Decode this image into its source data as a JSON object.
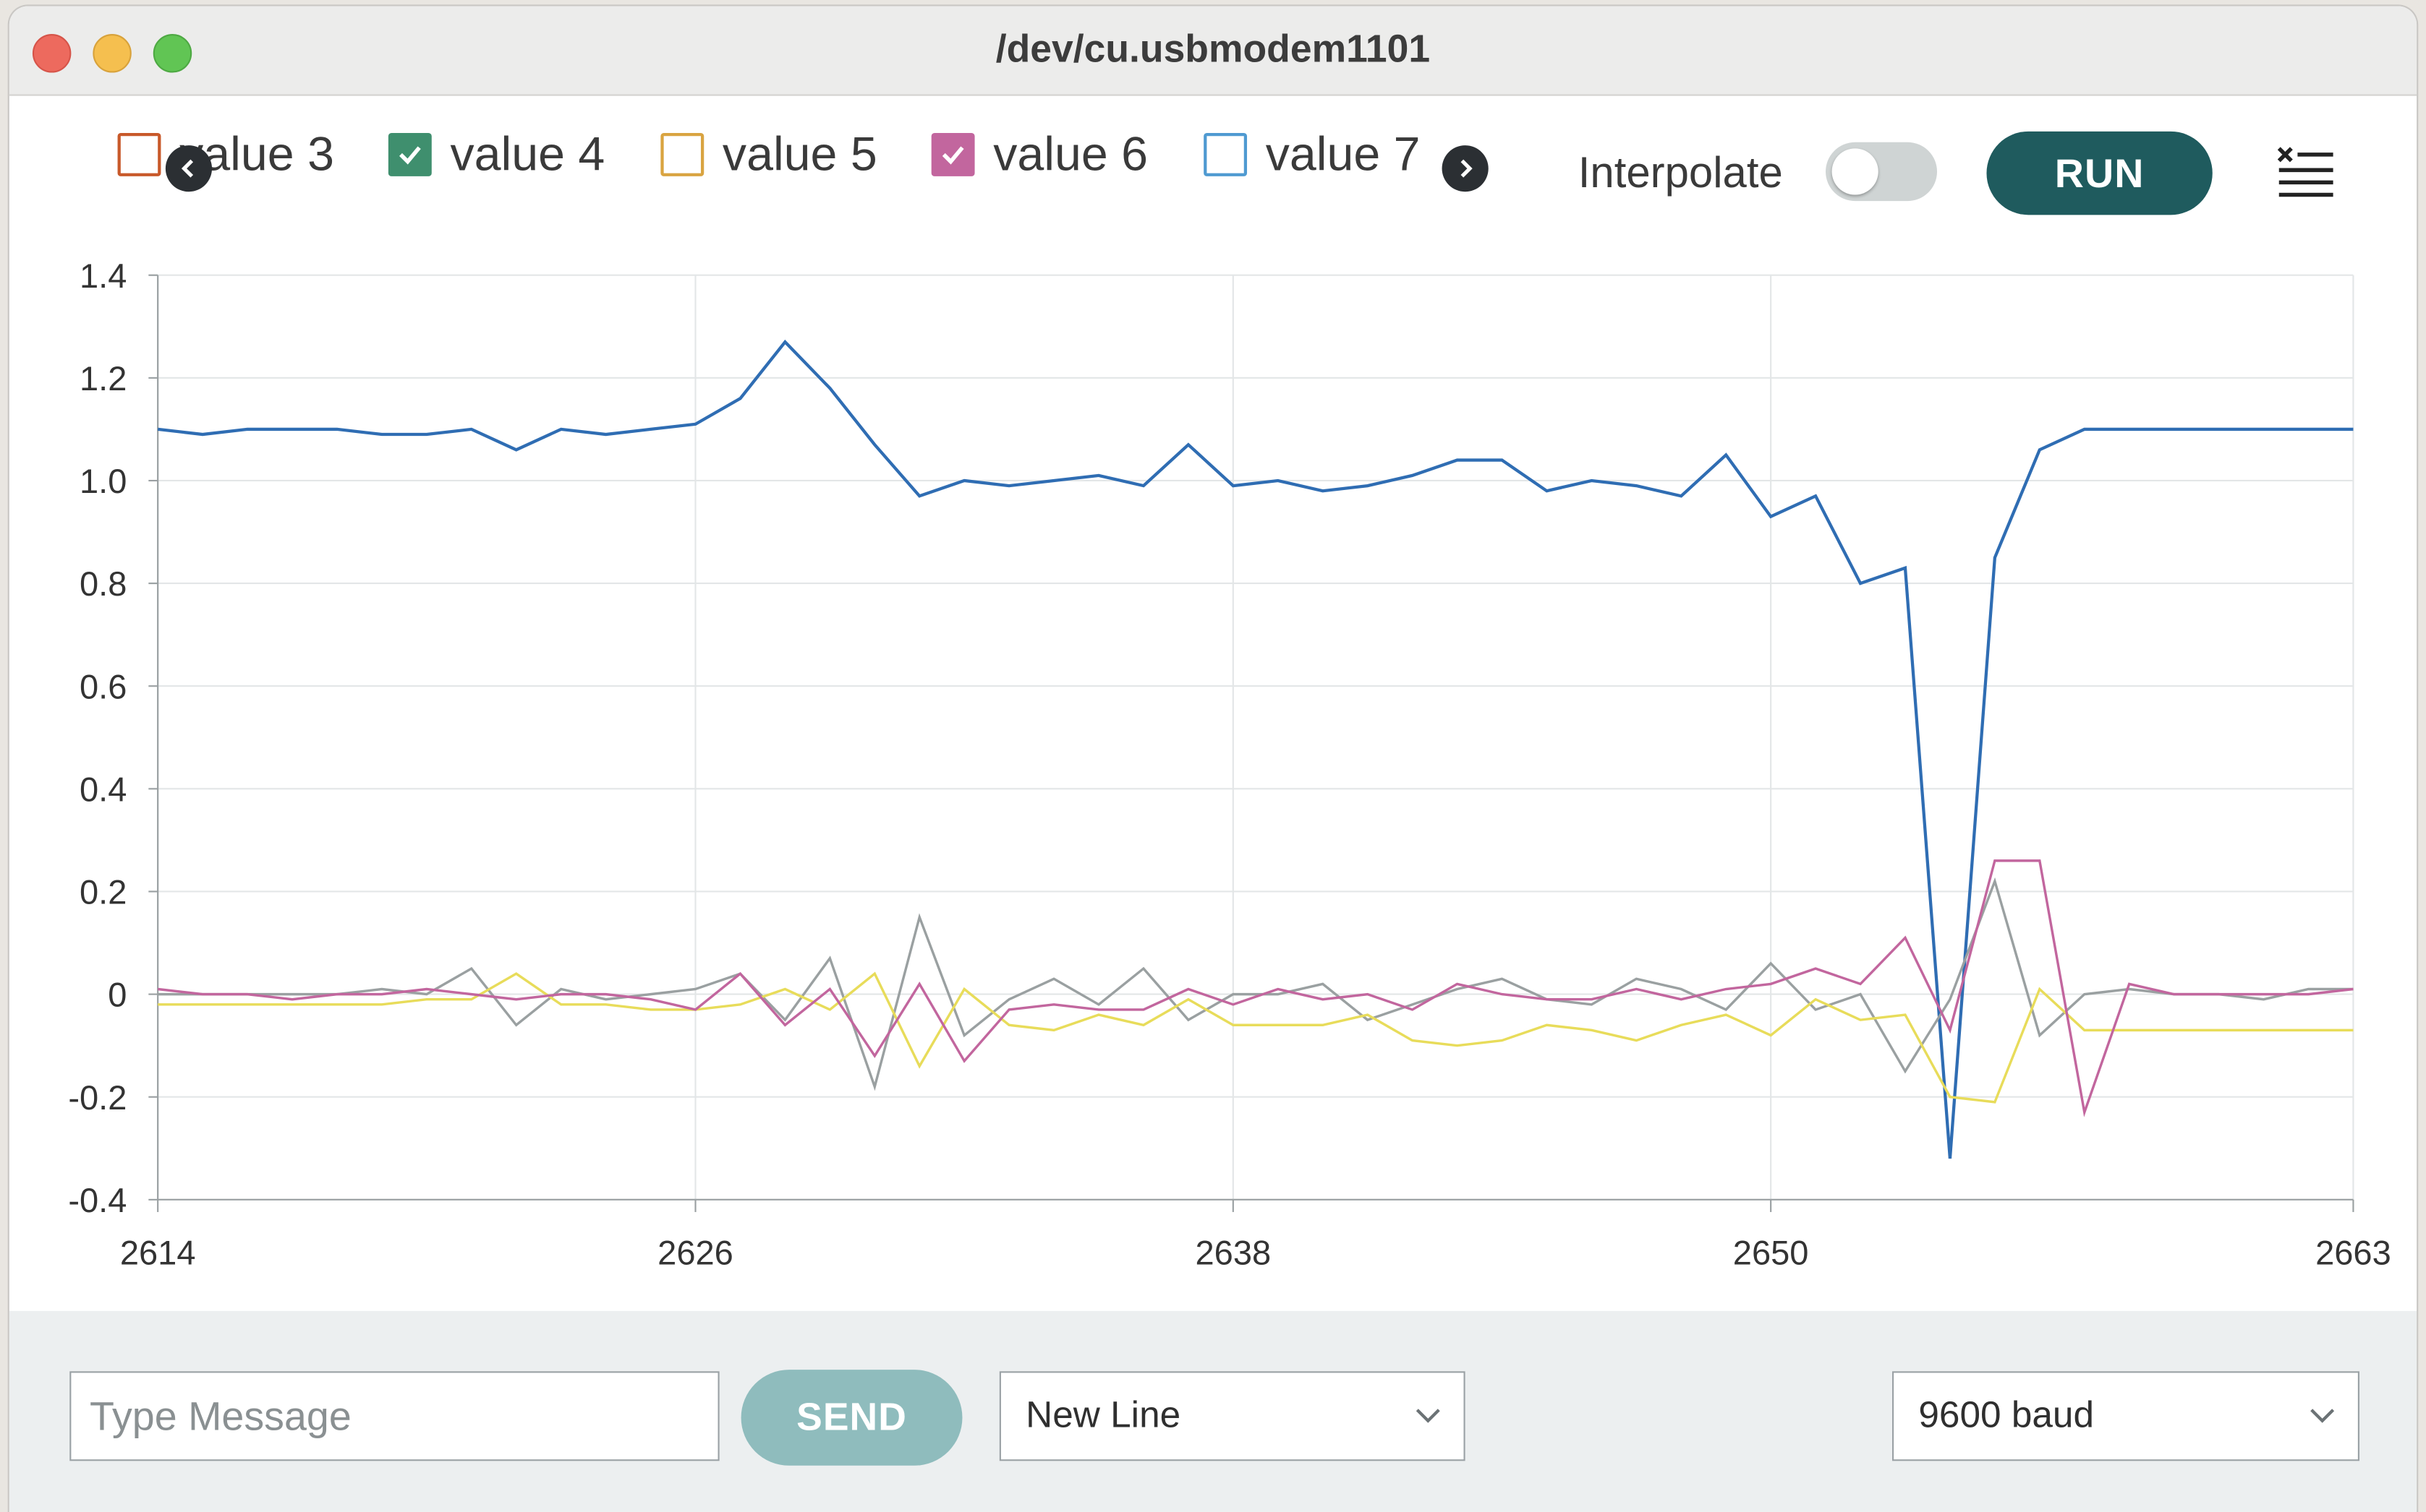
{
  "window": {
    "title": "/dev/cu.usbmodem1101"
  },
  "legend": {
    "items": [
      {
        "label": "value 3",
        "checked": false,
        "color": "#c8592a"
      },
      {
        "label": "value 4",
        "checked": true,
        "color": "#3f8f6e"
      },
      {
        "label": "value 5",
        "checked": false,
        "color": "#d9a441"
      },
      {
        "label": "value 6",
        "checked": true,
        "color": "#c2669e"
      },
      {
        "label": "value 7",
        "checked": false,
        "color": "#4f9ad1"
      }
    ],
    "prev_icon": "chevron-left-icon",
    "next_icon": "chevron-right-icon"
  },
  "toolbar": {
    "interpolate_label": "Interpolate",
    "interpolate_on": false,
    "run_label": "RUN",
    "menu_icon": "clear-list-icon"
  },
  "chart_data": {
    "type": "line",
    "x": [
      2614,
      2615,
      2616,
      2617,
      2618,
      2619,
      2620,
      2621,
      2622,
      2623,
      2624,
      2625,
      2626,
      2627,
      2628,
      2629,
      2630,
      2631,
      2632,
      2633,
      2634,
      2635,
      2636,
      2637,
      2638,
      2639,
      2640,
      2641,
      2642,
      2643,
      2644,
      2645,
      2646,
      2647,
      2648,
      2649,
      2650,
      2651,
      2652,
      2653,
      2654,
      2655,
      2656,
      2657,
      2658,
      2659,
      2660,
      2661,
      2662,
      2663
    ],
    "xticks": [
      "2614",
      "2626",
      "2638",
      "2650",
      "2663"
    ],
    "yticks": [
      "1.4",
      "1.2",
      "1.0",
      "0.8",
      "0.6",
      "0.4",
      "0.2",
      "0",
      "-0.2",
      "-0.4"
    ],
    "ylim": [
      -0.4,
      1.4
    ],
    "grid": true,
    "series": [
      {
        "color": "#2f6db3",
        "values": [
          1.1,
          1.09,
          1.1,
          1.1,
          1.1,
          1.09,
          1.09,
          1.1,
          1.06,
          1.1,
          1.09,
          1.1,
          1.11,
          1.16,
          1.27,
          1.18,
          1.07,
          0.97,
          1.0,
          0.99,
          1.0,
          1.01,
          0.99,
          1.07,
          0.99,
          1.0,
          0.98,
          0.99,
          1.01,
          1.04,
          1.04,
          0.98,
          1.0,
          0.99,
          0.97,
          1.05,
          0.93,
          0.97,
          0.8,
          0.83,
          -0.32,
          0.85,
          1.06,
          1.1,
          1.1,
          1.1,
          1.1,
          1.1,
          1.1,
          1.1
        ]
      },
      {
        "color": "#9aa0a1",
        "values": [
          0.0,
          0.0,
          0.0,
          0.0,
          0.0,
          0.01,
          0.0,
          0.05,
          -0.06,
          0.01,
          -0.01,
          0.0,
          0.01,
          0.04,
          -0.05,
          0.07,
          -0.18,
          0.15,
          -0.08,
          -0.01,
          0.03,
          -0.02,
          0.05,
          -0.05,
          0.0,
          0.0,
          0.02,
          -0.05,
          -0.02,
          0.01,
          0.03,
          -0.01,
          -0.02,
          0.03,
          0.01,
          -0.03,
          0.06,
          -0.03,
          0.0,
          -0.15,
          -0.01,
          0.22,
          -0.08,
          0.0,
          0.01,
          0.0,
          0.0,
          -0.01,
          0.01,
          0.01
        ]
      },
      {
        "color": "#e8dc5a",
        "values": [
          -0.02,
          -0.02,
          -0.02,
          -0.02,
          -0.02,
          -0.02,
          -0.01,
          -0.01,
          0.04,
          -0.02,
          -0.02,
          -0.03,
          -0.03,
          -0.02,
          0.01,
          -0.03,
          0.04,
          -0.14,
          0.01,
          -0.06,
          -0.07,
          -0.04,
          -0.06,
          -0.01,
          -0.06,
          -0.06,
          -0.06,
          -0.04,
          -0.09,
          -0.1,
          -0.09,
          -0.06,
          -0.07,
          -0.09,
          -0.06,
          -0.04,
          -0.08,
          -0.01,
          -0.05,
          -0.04,
          -0.2,
          -0.21,
          0.01,
          -0.07,
          -0.07,
          -0.07,
          -0.07,
          -0.07,
          -0.07,
          -0.07
        ]
      },
      {
        "color": "#c2669e",
        "values": [
          0.01,
          0.0,
          0.0,
          -0.01,
          0.0,
          0.0,
          0.01,
          0.0,
          -0.01,
          0.0,
          0.0,
          -0.01,
          -0.03,
          0.04,
          -0.06,
          0.01,
          -0.12,
          0.02,
          -0.13,
          -0.03,
          -0.02,
          -0.03,
          -0.03,
          0.01,
          -0.02,
          0.01,
          -0.01,
          0.0,
          -0.03,
          0.02,
          0.0,
          -0.01,
          -0.01,
          0.01,
          -0.01,
          0.01,
          0.02,
          0.05,
          0.02,
          0.11,
          -0.07,
          0.26,
          0.26,
          -0.23,
          0.02,
          0.0,
          0.0,
          0.0,
          0.0,
          0.01
        ]
      }
    ]
  },
  "footer": {
    "message_placeholder": "Type Message",
    "send_label": "SEND",
    "line_ending": "New Line",
    "baud": "9600 baud"
  }
}
